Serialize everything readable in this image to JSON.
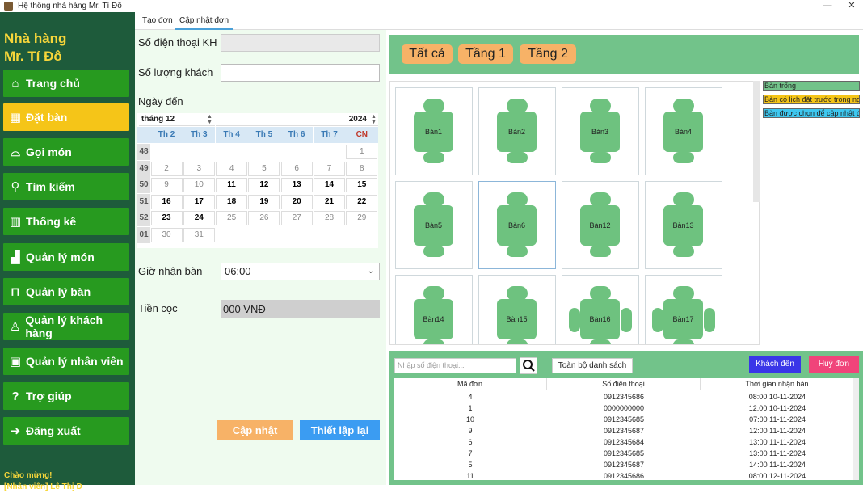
{
  "window": {
    "title": "Hệ thống nhà hàng Mr. Tí Đô",
    "minimize": "—",
    "close": "✕"
  },
  "sidebar": {
    "brand_line1": "Nhà hàng",
    "brand_line2": "Mr. Tí Đô",
    "items": [
      {
        "label": "Trang chủ",
        "icon": "home-icon",
        "glyph": "⌂"
      },
      {
        "label": "Đặt bàn",
        "icon": "calendar-grid-icon",
        "glyph": "▦"
      },
      {
        "label": "Gọi món",
        "icon": "cloche-icon",
        "glyph": "⌓"
      },
      {
        "label": "Tìm kiếm",
        "icon": "search-icon",
        "glyph": "⚲"
      },
      {
        "label": "Thống kê",
        "icon": "bar-chart-icon",
        "glyph": "▥"
      },
      {
        "label": "Quản lý món",
        "icon": "dish-icon",
        "glyph": "▟"
      },
      {
        "label": "Quản lý bàn",
        "icon": "chair-icon",
        "glyph": "⊓"
      },
      {
        "label": "Quản lý khách hàng",
        "icon": "person-icon",
        "glyph": "♙"
      },
      {
        "label": "Quản lý nhân viên",
        "icon": "id-badge-icon",
        "glyph": "▣"
      },
      {
        "label": "Trợ giúp",
        "icon": "help-icon",
        "glyph": "?"
      },
      {
        "label": "Đăng xuất",
        "icon": "logout-icon",
        "glyph": "➜"
      }
    ],
    "active_index": 1,
    "welcome_line1": "Chào mừng!",
    "welcome_line2": "[Nhân viên] Lê Thị D"
  },
  "tabs": [
    {
      "label": "Tạo đơn"
    },
    {
      "label": "Cập nhật đơn"
    }
  ],
  "active_tab": 1,
  "form": {
    "phone_label": "Số điện thoại KH",
    "phone_value": "",
    "guests_label": "Số lượng khách",
    "guests_value": "",
    "date_label": "Ngày đến",
    "time_label": "Giờ nhận bàn",
    "time_value": "06:00",
    "deposit_label": "Tiền cọc",
    "deposit_value": "000 VNĐ",
    "update_button": "Cập nhật",
    "reset_button": "Thiết lập lại"
  },
  "calendar": {
    "month": "tháng 12",
    "year": "2024",
    "weekdays": [
      "Th 2",
      "Th 3",
      "Th 4",
      "Th 5",
      "Th 6",
      "Th 7",
      "CN"
    ],
    "weeks": [
      {
        "no": "48",
        "days": [
          "",
          "",
          "",
          "",
          "",
          "",
          "1"
        ],
        "current": [
          false,
          false,
          false,
          false,
          false,
          false,
          false
        ]
      },
      {
        "no": "49",
        "days": [
          "2",
          "3",
          "4",
          "5",
          "6",
          "7",
          "8"
        ],
        "current": [
          false,
          false,
          false,
          false,
          false,
          false,
          false
        ]
      },
      {
        "no": "50",
        "days": [
          "9",
          "10",
          "11",
          "12",
          "13",
          "14",
          "15"
        ],
        "current": [
          false,
          false,
          true,
          true,
          true,
          true,
          true
        ]
      },
      {
        "no": "51",
        "days": [
          "16",
          "17",
          "18",
          "19",
          "20",
          "21",
          "22"
        ],
        "current": [
          true,
          true,
          true,
          true,
          true,
          true,
          true
        ]
      },
      {
        "no": "52",
        "days": [
          "23",
          "24",
          "25",
          "26",
          "27",
          "28",
          "29"
        ],
        "current": [
          true,
          true,
          false,
          false,
          false,
          false,
          false
        ]
      },
      {
        "no": "01",
        "days": [
          "30",
          "31",
          "",
          "",
          "",
          "",
          ""
        ],
        "current": [
          false,
          false,
          false,
          false,
          false,
          false,
          false
        ]
      }
    ]
  },
  "floors": [
    "Tất cả",
    "Tầng 1",
    "Tầng 2"
  ],
  "tables": [
    {
      "name": "Bàn1",
      "style": "4",
      "selected": false
    },
    {
      "name": "Bàn2",
      "style": "4",
      "selected": false
    },
    {
      "name": "Bàn3",
      "style": "4",
      "selected": false
    },
    {
      "name": "Bàn4",
      "style": "4",
      "selected": false
    },
    {
      "name": "Bàn5",
      "style": "4",
      "selected": false
    },
    {
      "name": "Bàn6",
      "style": "4",
      "selected": true
    },
    {
      "name": "Bàn12",
      "style": "4",
      "selected": false
    },
    {
      "name": "Bàn13",
      "style": "4",
      "selected": false
    },
    {
      "name": "Bàn14",
      "style": "4",
      "selected": false
    },
    {
      "name": "Bàn15",
      "style": "4",
      "selected": false
    },
    {
      "name": "Bàn16",
      "style": "6",
      "selected": false
    },
    {
      "name": "Bàn17",
      "style": "6",
      "selected": false
    }
  ],
  "legend": [
    {
      "label": "Bàn trống",
      "color": "#72c38a"
    },
    {
      "label": "Bàn có lịch đặt trước trong ngày",
      "color": "#f5c518"
    },
    {
      "label": "Bàn được chọn để cập nhật đơn",
      "color": "#3ec8f0"
    }
  ],
  "orders": {
    "search_placeholder": "Nhập số điện thoại...",
    "all_button": "Toàn bộ danh sách",
    "arrive_button": "Khách đến",
    "cancel_button": "Huỷ đơn",
    "columns": [
      "Mã đơn",
      "Số điện thoại",
      "Thời gian nhận bàn"
    ],
    "rows": [
      [
        "4",
        "0912345686",
        "08:00 10-11-2024"
      ],
      [
        "1",
        "0000000000",
        "12:00 10-11-2024"
      ],
      [
        "10",
        "0912345685",
        "07:00 11-11-2024"
      ],
      [
        "9",
        "0912345687",
        "12:00 11-11-2024"
      ],
      [
        "6",
        "0912345684",
        "13:00 11-11-2024"
      ],
      [
        "7",
        "0912345685",
        "13:00 11-11-2024"
      ],
      [
        "5",
        "0912345687",
        "14:00 11-11-2024"
      ],
      [
        "11",
        "0912345686",
        "08:00 12-11-2024"
      ]
    ]
  }
}
